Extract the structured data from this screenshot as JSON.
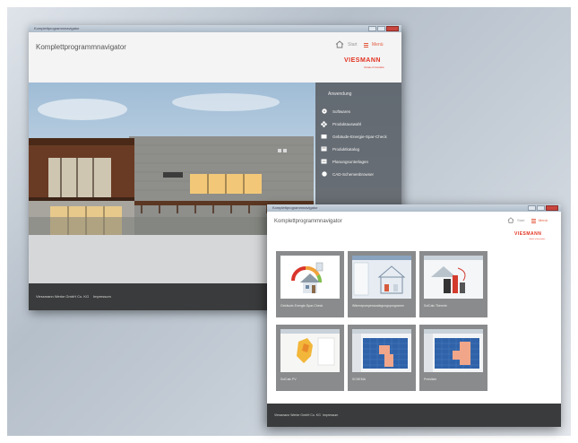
{
  "back_window": {
    "tab_title": "Komplettprogrammnavigator",
    "app_title": "Komplettprogrammnavigator",
    "nav": {
      "start_label": "Start",
      "menu_label": "Menü"
    },
    "logo": {
      "name": "VIESMANN",
      "tagline": "climate of innovation"
    },
    "side_menu": {
      "heading": "Anwendung",
      "items": [
        {
          "label": "Softwares",
          "icon": "disc-icon"
        },
        {
          "label": "Produktauswahl",
          "icon": "puzzle-icon"
        },
        {
          "label": "Gebäude-Energie-Spar-Check",
          "icon": "house-icon"
        },
        {
          "label": "Produktkatalog",
          "icon": "catalog-icon"
        },
        {
          "label": "Planungsunterlagen",
          "icon": "documents-icon"
        },
        {
          "label": "CAD-Schemenbrowser",
          "icon": "cad-icon"
        }
      ]
    },
    "footer": {
      "company": "Viessmann Werke GmbH Co. KG",
      "link": "Impressum"
    }
  },
  "front_window": {
    "tab_title": "Komplettprogrammnavigator",
    "app_title": "Komplettprogrammnavigator",
    "nav": {
      "start_label": "Start",
      "menu_label": "Menü"
    },
    "logo": {
      "name": "VIESMANN",
      "tagline": "climate of innovation"
    },
    "tiles": [
      {
        "label": "Gebäude-Energie-Spar-Check",
        "icon": "house-energy-thumbnail"
      },
      {
        "label": "Wärmepumpenauslegungsprogramm",
        "icon": "heat-pump-thumbnail"
      },
      {
        "label": "SolCalc Thermie",
        "icon": "solar-thermal-thumbnail"
      },
      {
        "label": "SolCalc PV",
        "icon": "solar-pv-thumbnail"
      },
      {
        "label": "SCHEMA",
        "icon": "schema-thumbnail"
      },
      {
        "label": "Preislistе",
        "icon": "price-list-thumbnail"
      }
    ],
    "footer": {
      "company": "Viessmann Werke GmbH Co. KG",
      "link": "Impressum"
    }
  },
  "colors": {
    "accent": "#e25b3e",
    "brand": "#e2311f",
    "footer": "#3a3b3c",
    "tile": "#8a8b8c"
  }
}
